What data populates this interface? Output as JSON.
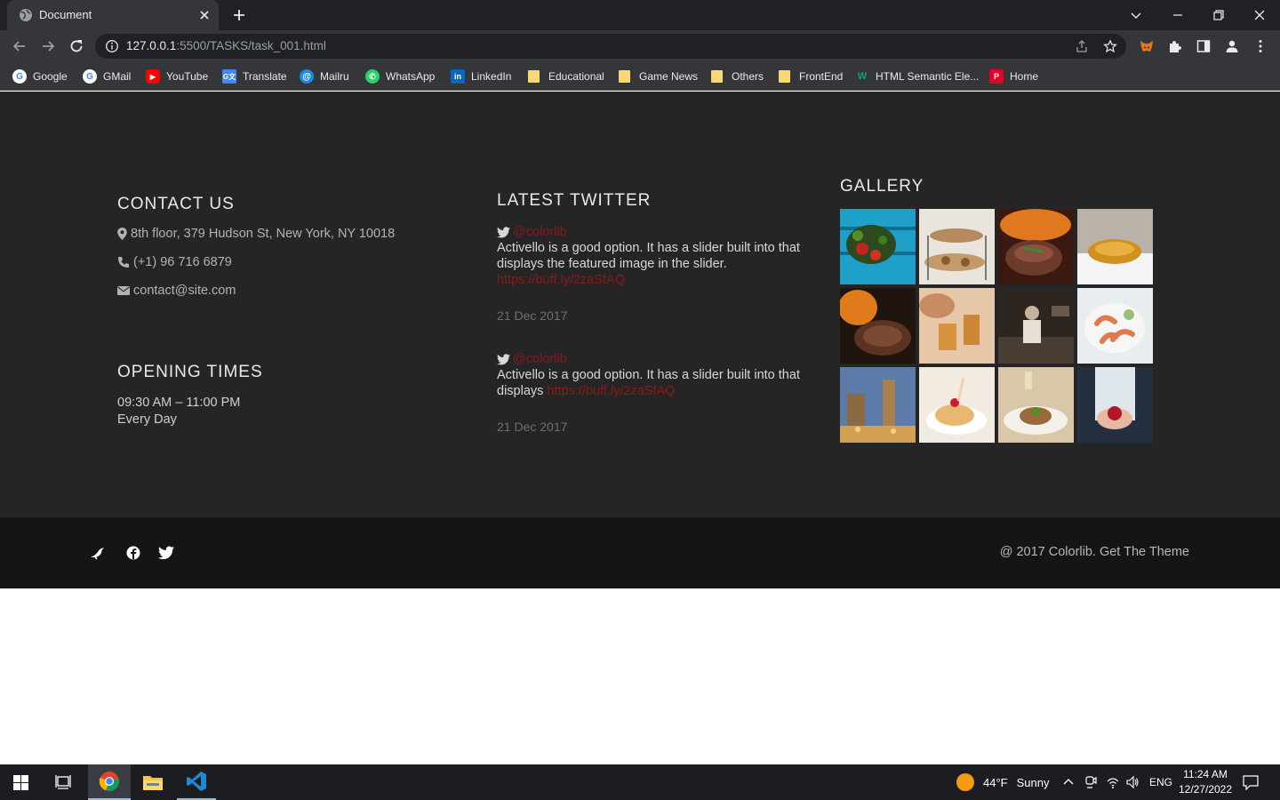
{
  "browser": {
    "tab_title": "Document",
    "url_host": "127.0.0.1",
    "url_rest": ":5500/TASKS/task_001.html",
    "bookmarks": [
      {
        "label": "Google",
        "icon": "google-icon",
        "color": "#ffffff"
      },
      {
        "label": "GMail",
        "icon": "google-icon",
        "color": "#ffffff"
      },
      {
        "label": "YouTube",
        "icon": "youtube-icon",
        "color": "#ff0000"
      },
      {
        "label": "Translate",
        "icon": "translate-icon",
        "color": "#4285f4"
      },
      {
        "label": "Mailru",
        "icon": "mailru-icon",
        "color": "#168de2"
      },
      {
        "label": "WhatsApp",
        "icon": "whatsapp-icon",
        "color": "#25d366"
      },
      {
        "label": "LinkedIn",
        "icon": "linkedin-icon",
        "color": "#0a66c2"
      },
      {
        "label": "Educational",
        "icon": "folder-icon",
        "color": "#f8d774"
      },
      {
        "label": "Game News",
        "icon": "folder-icon",
        "color": "#f8d774"
      },
      {
        "label": "Others",
        "icon": "folder-icon",
        "color": "#f8d774"
      },
      {
        "label": "FrontEnd",
        "icon": "folder-icon",
        "color": "#f8d774"
      },
      {
        "label": "HTML Semantic Ele...",
        "icon": "w3-icon",
        "color": "#04aa6d"
      },
      {
        "label": "Home",
        "icon": "pinterest-icon",
        "color": "#e60023"
      }
    ]
  },
  "contact": {
    "heading": "CONTACT US",
    "address": "8th floor, 379 Hudson St, New York, NY 10018",
    "phone": "(+1) 96 716 6879",
    "email": "contact@site.com"
  },
  "opening": {
    "heading": "OPENING TIMES",
    "hours": "09:30 AM – 11:00 PM",
    "days": "Every Day"
  },
  "twitter": {
    "heading": "LATEST TWITTER",
    "tweets": [
      {
        "handle": "@colorlib",
        "text": "Activello is a good option. It has a slider built into that displays the featured image in the slider.",
        "link": "https://buff.ly/2zaSfAQ",
        "date": "21 Dec 2017"
      },
      {
        "handle": "@colorlib",
        "text": "Activello is a good option. It has a slider built into that displays",
        "link": "https://buff.ly/2zaSfAQ",
        "date": "21 Dec 2017"
      }
    ]
  },
  "gallery": {
    "heading": "GALLERY"
  },
  "footer": {
    "copyright": "@ 2017 Colorlib. Get The Theme"
  },
  "taskbar": {
    "weather_temp": "44°F",
    "weather_text": "Sunny",
    "language": "ENG",
    "time": "11:24 AM",
    "date": "12/27/2022"
  },
  "colors": {
    "footer_bg": "#252525",
    "footer_bottom_bg": "#151515",
    "link": "#8a1a1a",
    "heading": "#e9e9e9"
  }
}
